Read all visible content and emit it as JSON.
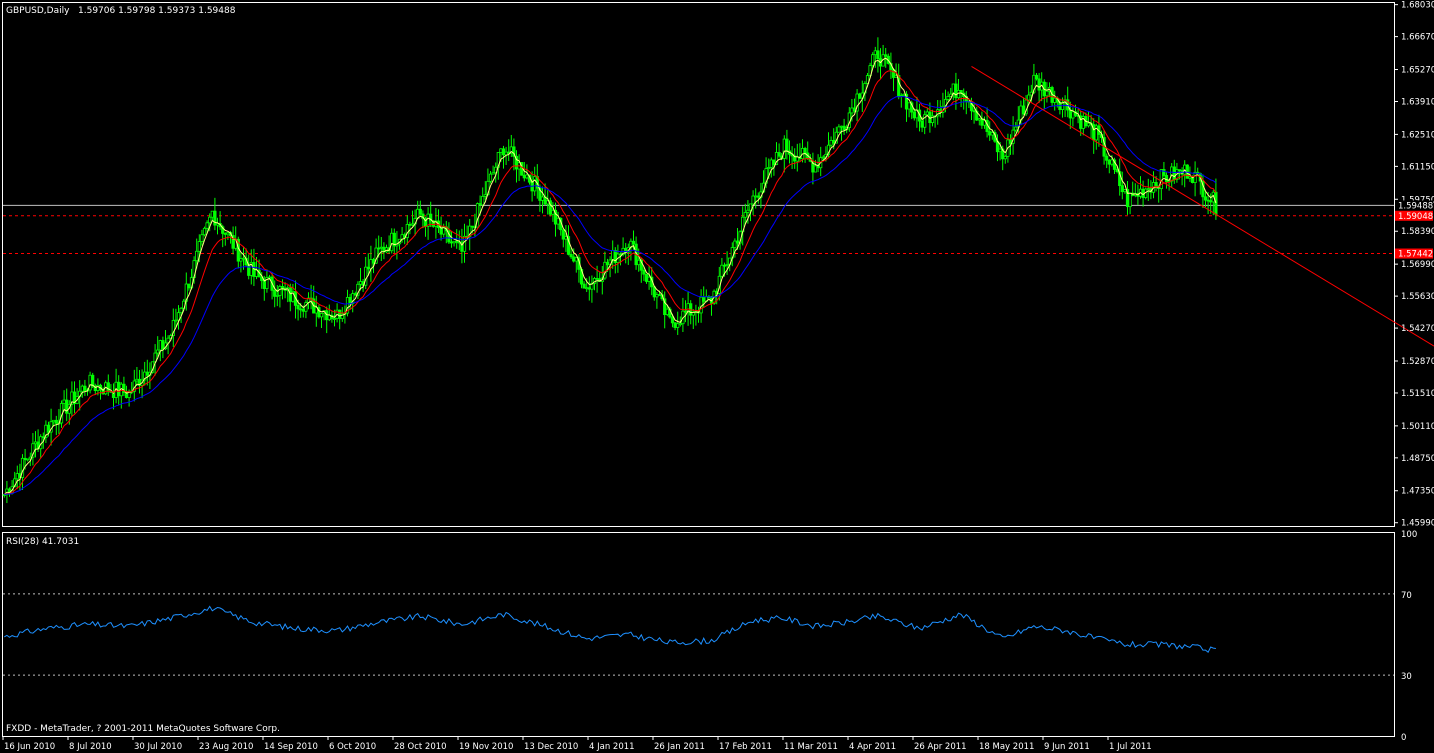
{
  "header": {
    "symbol_label": "GBPUSD,Daily",
    "ohlc": "1.59706 1.59798 1.59373 1.59488"
  },
  "rsi_panel": {
    "label": "RSI(28) 41.7031",
    "levels": [
      "100",
      "70",
      "30",
      "0"
    ]
  },
  "footer": {
    "copyright": "FXDD - MetaTrader, ? 2001-2011 MetaQuotes Software Corp."
  },
  "colors": {
    "background": "#000000",
    "candle": "#00ff00",
    "ma_fast": "#ffff80",
    "ma_mid": "#ff0000",
    "ma_slow": "#0000ff",
    "rsi_line": "#1e90ff",
    "trendline": "#ff0000",
    "price_marker": "#ff0000"
  },
  "chart_data": [
    {
      "type": "candlestick",
      "price_axis_labels": [
        "1.68030",
        "1.66670",
        "1.65270",
        "1.63910",
        "1.62510",
        "1.61150",
        "1.59750",
        "1.58390",
        "1.56990",
        "1.55630",
        "1.54270",
        "1.52870",
        "1.51510",
        "1.50110",
        "1.48750",
        "1.47350",
        "1.45990"
      ],
      "ylim": [
        1.4585,
        1.681
      ],
      "date_axis_labels": [
        "16 Jun 2010",
        "8 Jul 2010",
        "30 Jul 2010",
        "23 Aug 2010",
        "14 Sep 2010",
        "6 Oct 2010",
        "28 Oct 2010",
        "19 Nov 2010",
        "13 Dec 2010",
        "4 Jan 2011",
        "26 Jan 2011",
        "17 Feb 2011",
        "11 Mar 2011",
        "4 Apr 2011",
        "26 Apr 2011",
        "18 May 2011",
        "9 Jun 2011",
        "1 Jul 2011"
      ],
      "current_price": {
        "label": "1.59488",
        "value": 1.59488
      },
      "horizontal_lines": [
        {
          "label": "1.59048",
          "value": 1.59048
        },
        {
          "label": "1.57442",
          "value": 1.57442
        }
      ],
      "series": [
        {
          "name": "close",
          "x": [
            0,
            16,
            32,
            48,
            64,
            80,
            96,
            112,
            128,
            144,
            160,
            176,
            192,
            208,
            224,
            240,
            256,
            272,
            288,
            300,
            312,
            324,
            336,
            352,
            368
          ],
          "y": [
            1.472,
            1.5,
            1.519,
            1.515,
            1.54,
            1.592,
            1.565,
            1.555,
            1.548,
            1.575,
            1.591,
            1.575,
            1.62,
            1.598,
            1.56,
            1.58,
            1.545,
            1.555,
            1.598,
            1.62,
            1.612,
            1.632,
            1.66,
            1.63,
            1.646
          ]
        },
        {
          "name": "close_2",
          "x": [
            384,
            396,
            408,
            420,
            432,
            444,
            456,
            466
          ],
          "y": [
            1.615,
            1.648,
            1.638,
            1.625,
            1.597,
            1.606,
            1.61,
            1.595
          ]
        }
      ],
      "trendline": {
        "start": {
          "x": 372,
          "y": 1.654
        },
        "end": {
          "x": 535,
          "y": 1.545
        }
      }
    },
    {
      "type": "line",
      "ylim": [
        0,
        100
      ],
      "levels": [
        70,
        30
      ],
      "current_value": 41.7031,
      "series": [
        {
          "x": [
            0,
            16,
            32,
            48,
            64,
            80,
            96,
            112,
            128,
            144,
            160,
            176,
            192,
            208,
            224,
            240,
            256,
            272,
            288,
            300,
            312,
            324,
            336,
            352,
            368,
            384,
            396,
            408,
            420,
            432,
            444,
            456,
            466
          ],
          "y": [
            49,
            53,
            55,
            54,
            58,
            63,
            56,
            53,
            52,
            56,
            59,
            55,
            60,
            54,
            48,
            50,
            46,
            47,
            57,
            58,
            54,
            56,
            59,
            53,
            60,
            48,
            54,
            52,
            48,
            45,
            45,
            44,
            42
          ]
        }
      ]
    }
  ]
}
